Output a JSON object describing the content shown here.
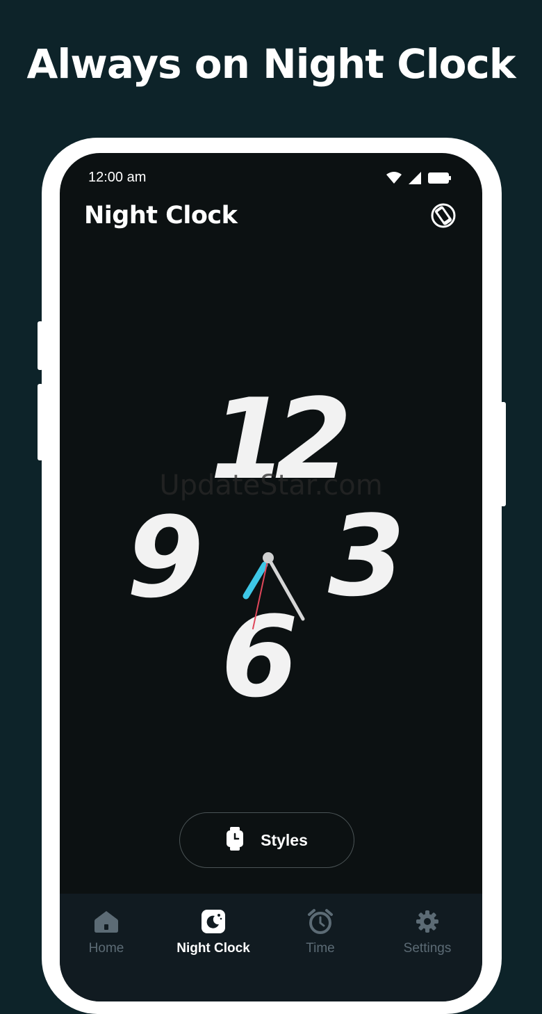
{
  "headline": "Always on Night Clock",
  "status_bar": {
    "time": "12:00 am",
    "icons": [
      "wifi-icon",
      "signal-icon",
      "battery-icon"
    ]
  },
  "app_bar": {
    "title": "Night Clock",
    "action_icon": "screen-rotate-icon"
  },
  "clock": {
    "numerals": {
      "twelve": "12",
      "three": "3",
      "six": "6",
      "nine": "9"
    },
    "hand_colors": {
      "hour": "#3ec7e6",
      "minute": "#d6d6d6",
      "second": "#e0475a"
    }
  },
  "watermark": "UpdateStar.com",
  "styles_button": {
    "label": "Styles",
    "icon": "watch-icon"
  },
  "bottom_nav": {
    "items": [
      {
        "label": "Home",
        "icon": "home-icon",
        "active": false
      },
      {
        "label": "Night Clock",
        "icon": "night-clock-icon",
        "active": true
      },
      {
        "label": "Time",
        "icon": "alarm-clock-icon",
        "active": false
      },
      {
        "label": "Settings",
        "icon": "gear-icon",
        "active": false
      }
    ]
  },
  "colors": {
    "background": "#0d2329",
    "screen": "#0c1112",
    "nav_inactive": "#5c6b75",
    "accent": "#3ec7e6"
  }
}
